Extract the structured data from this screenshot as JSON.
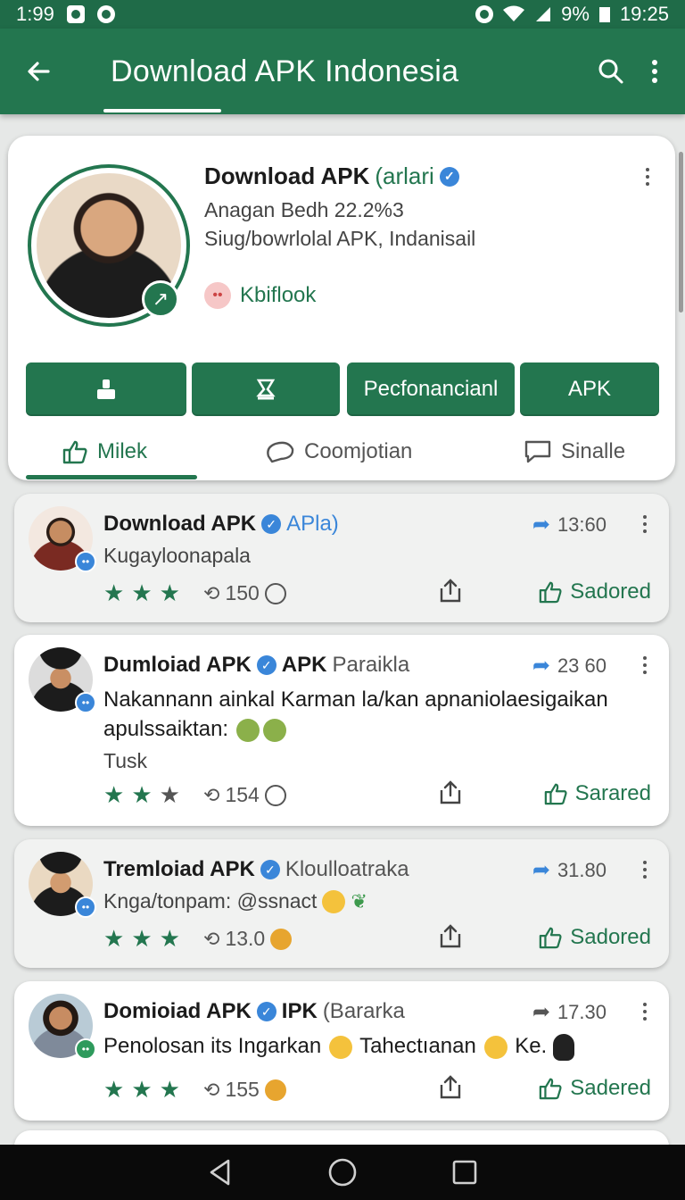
{
  "status_bar": {
    "time_left": "1:99",
    "battery": "9%",
    "time_right": "19:25"
  },
  "app_bar": {
    "title": "Download APK Indonesia"
  },
  "profile": {
    "name": "Download APK",
    "name_suffix": "(arlari",
    "line1": "Anagan Bedh 22.2%3",
    "line2": "Siug/bowrlolal APK, Indanisail",
    "link": "Kbiflook",
    "buttons": [
      "Pecfonancianl",
      "APK"
    ],
    "tabs": [
      "Milek",
      "Coomjotian",
      "Sinalle"
    ]
  },
  "posts": [
    {
      "author": "Download APK",
      "tag": "APla)",
      "tag_style": "blue",
      "time": "13:60",
      "sub": "Kugayloonapala",
      "body": "",
      "body_extra": "",
      "stars": 3,
      "count": "150",
      "saved": "Sadored"
    },
    {
      "author": "Dumloiad APK",
      "tag": "APK",
      "tag2": "Paraikla",
      "time": "23 60",
      "body": "Nakannann ainkal Karman la/kan apnaniolaesigaikan apulssaiktan:",
      "body_extra": "Tusk",
      "stars": 2,
      "count": "154",
      "saved": "Sarared"
    },
    {
      "author": "Tremloiad APK",
      "tag2": "Kloulloatraka",
      "time": "31.80",
      "sub": "Knga/tonpam: @ssnact",
      "stars": 3,
      "count": "13.0",
      "saved": "Sadored"
    },
    {
      "author": "Domioiad APK",
      "tag": "IPK",
      "tag2": "(Bararka",
      "time": "17.30",
      "body": "Penolosan its Ingarkan",
      "body_b": "Tahectıanan",
      "body_c": "Ke.",
      "stars": 3,
      "count": "155",
      "saved": "Sadered"
    }
  ],
  "colors": {
    "primary": "#23764f",
    "accent_blue": "#3a86d9"
  }
}
